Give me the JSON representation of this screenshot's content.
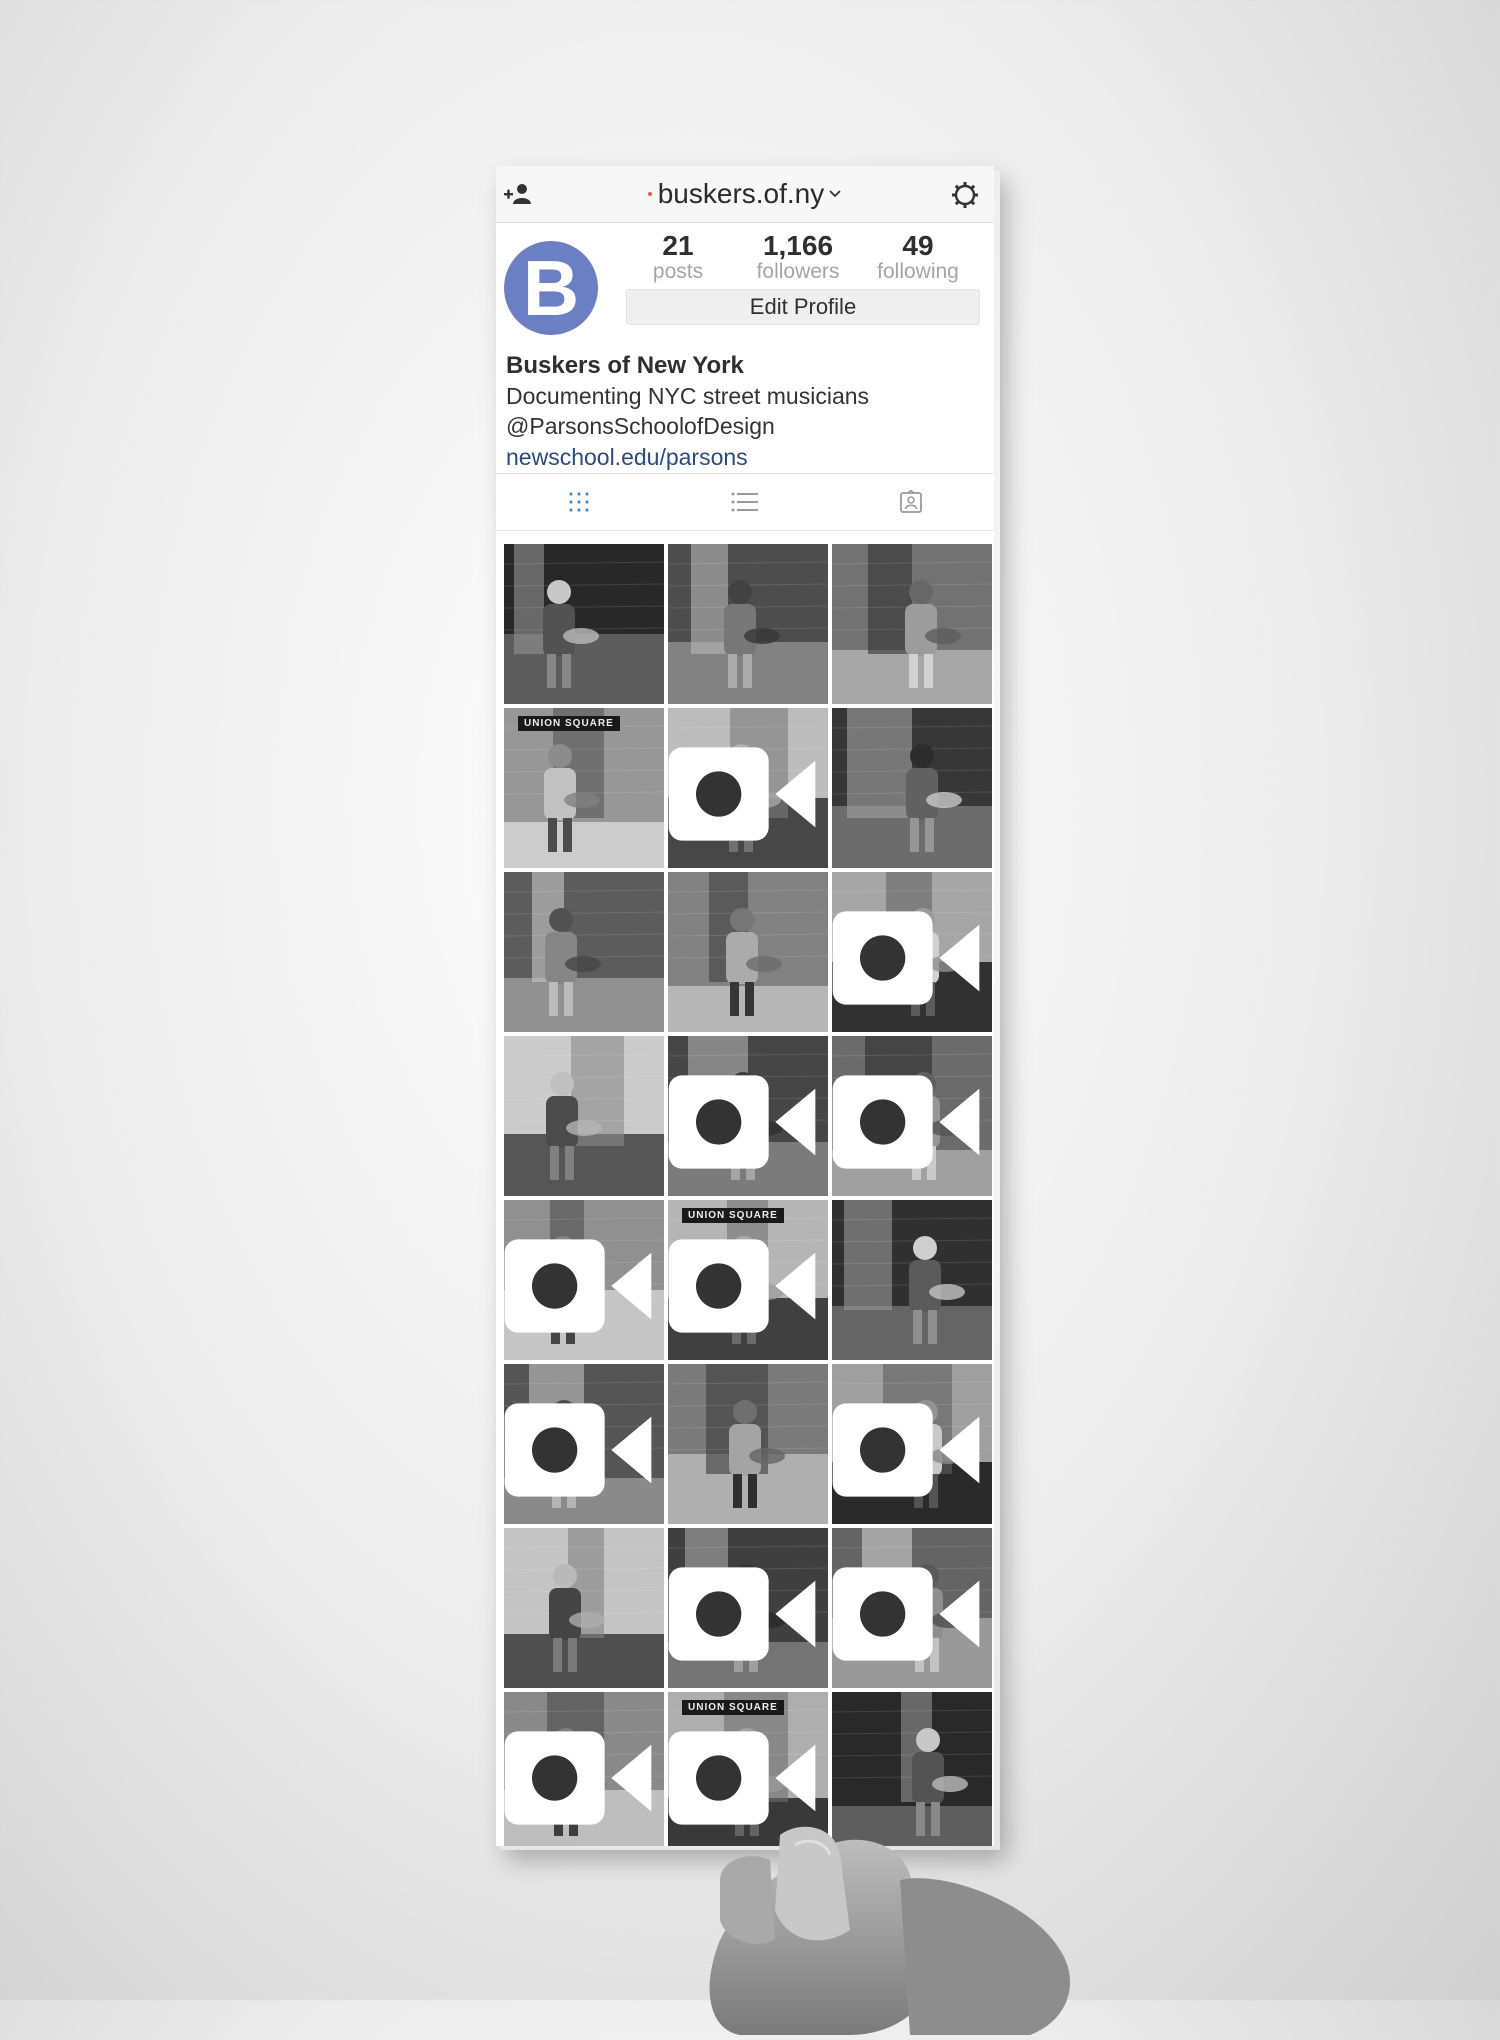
{
  "app": {
    "username": "buskers.of.ny"
  },
  "profile": {
    "avatar_letter": "B",
    "avatar_color": "#6d7fc4",
    "stats": [
      {
        "value": "21",
        "label": "posts"
      },
      {
        "value": "1,166",
        "label": "followers"
      },
      {
        "value": "49",
        "label": "following"
      }
    ],
    "edit_button": "Edit Profile",
    "name": "Buskers of New York",
    "bio_lines": [
      "Documenting NYC street musicians",
      "@ParsonsSchoolofDesign"
    ],
    "link": "newschool.edu/parsons",
    "link_color": "#2d4a7c"
  },
  "tabs": [
    {
      "icon": "grid-icon",
      "active": true
    },
    {
      "icon": "list-icon",
      "active": false
    },
    {
      "icon": "tagged-icon",
      "active": false
    }
  ],
  "posts": [
    {
      "video": false
    },
    {
      "video": false
    },
    {
      "video": false
    },
    {
      "video": false,
      "caption": "UNION SQUARE"
    },
    {
      "video": true
    },
    {
      "video": false
    },
    {
      "video": false
    },
    {
      "video": false
    },
    {
      "video": true
    },
    {
      "video": false
    },
    {
      "video": true
    },
    {
      "video": true
    },
    {
      "video": true
    },
    {
      "video": true,
      "caption": "UNION SQUARE"
    },
    {
      "video": false
    },
    {
      "video": true
    },
    {
      "video": false
    },
    {
      "video": true
    },
    {
      "video": false
    },
    {
      "video": true
    },
    {
      "video": true
    },
    {
      "video": true
    },
    {
      "video": true,
      "caption": "UNION SQUARE"
    },
    {
      "video": false
    }
  ]
}
